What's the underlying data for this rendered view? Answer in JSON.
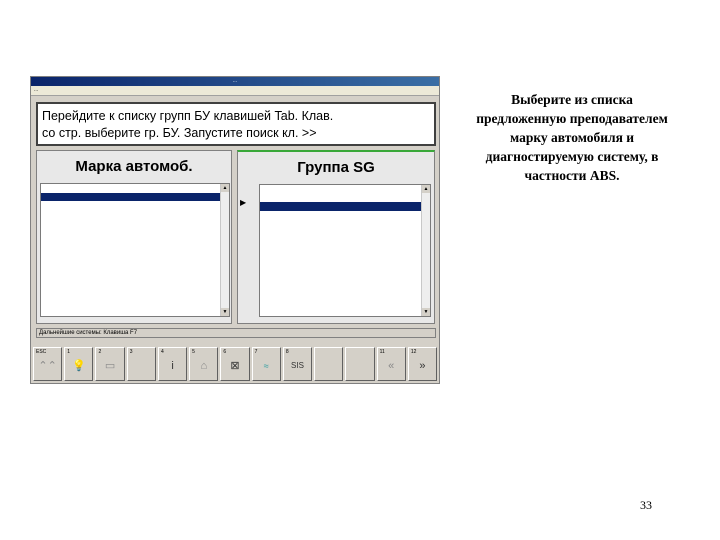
{
  "slide": {
    "caption": "Выберите из списка\nпредложенную преподавателем\nмарку автомобиля и\nдиагностируемую систему, в\nчастности ABS.",
    "page_number": "33"
  },
  "app": {
    "title_bar": "...",
    "menu_line": "...",
    "instruction_text": "Перейдите к списку групп БУ клавишей Tab. Клав.\nсо стр. выберите гр. БУ. Запустите поиск кл. >>",
    "left_panel": {
      "header": "Марка автомоб.",
      "items": [
        "",
        "",
        "",
        "",
        "",
        "",
        "",
        "",
        "",
        "",
        "",
        "",
        "",
        "",
        ""
      ],
      "selected_index": 1
    },
    "right_panel": {
      "header": "Группа SG",
      "items": [
        "",
        "",
        "",
        "",
        "",
        "",
        "",
        "",
        "",
        "",
        "",
        "",
        "",
        "",
        "",
        "",
        ""
      ],
      "selected_index": 2
    },
    "status_text": "Дальнейшие системы: Клавиша F7",
    "fkeys": [
      {
        "label": "ESC",
        "glyph": "⌃⌃",
        "icon": "up-arrows-icon",
        "style": "gray"
      },
      {
        "label": "1",
        "glyph": "💡",
        "icon": "lightbulb-icon",
        "style": "yellow"
      },
      {
        "label": "2",
        "glyph": "▭",
        "icon": "keyboard-icon",
        "style": "gray"
      },
      {
        "label": "3",
        "glyph": "",
        "icon": "",
        "style": ""
      },
      {
        "label": "4",
        "glyph": "i",
        "icon": "info-icon",
        "style": ""
      },
      {
        "label": "5",
        "glyph": "⌂",
        "icon": "gauge-icon",
        "style": "gray"
      },
      {
        "label": "6",
        "glyph": "⊠",
        "icon": "envelope-icon",
        "style": ""
      },
      {
        "label": "7",
        "glyph": "≈",
        "icon": "wave-icon",
        "style": "teal"
      },
      {
        "label": "8",
        "glyph": "SIS",
        "icon": "sis-text",
        "style": "text"
      },
      {
        "label": "",
        "glyph": "",
        "icon": "",
        "style": ""
      },
      {
        "label": "",
        "glyph": "",
        "icon": "",
        "style": ""
      },
      {
        "label": "11",
        "glyph": "«",
        "icon": "double-chevron-left-icon",
        "style": "gray"
      },
      {
        "label": "12",
        "glyph": "»",
        "icon": "double-chevron-right-icon",
        "style": ""
      }
    ]
  }
}
